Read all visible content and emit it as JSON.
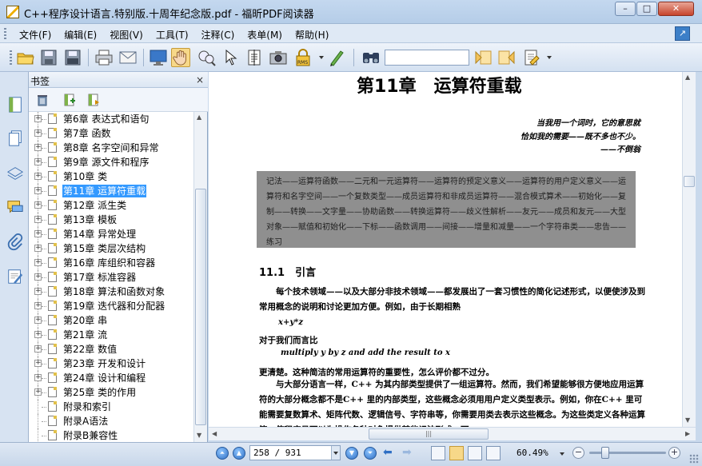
{
  "window": {
    "title": "C++程序设计语言.特别版.十周年纪念版.pdf - 福昕PDF阅读器",
    "minimize": "–",
    "maximize": "□",
    "close": "✕"
  },
  "menubar": {
    "items": [
      "文件(F)",
      "编辑(E)",
      "视图(V)",
      "工具(T)",
      "注释(C)",
      "表单(M)",
      "帮助(H)"
    ]
  },
  "toolbar": {
    "icons": [
      "open-icon",
      "save-icon",
      "save-as-icon",
      "print-icon",
      "email-icon",
      "fullscreen-icon",
      "hand-icon",
      "zoom-tool-icon",
      "select-icon",
      "text-select-icon",
      "snapshot-icon",
      "rms-icon",
      "typewriter-icon",
      "find-icon",
      "find-prev-icon",
      "find-next-icon",
      "highlight-icon"
    ],
    "search_value": ""
  },
  "bookmarks": {
    "title": "书签",
    "close": "×",
    "items": [
      {
        "label": "第6章 表达式和语句",
        "leaf": false
      },
      {
        "label": "第7章 函数",
        "leaf": false
      },
      {
        "label": "第8章 名字空间和异常",
        "leaf": false
      },
      {
        "label": "第9章 源文件和程序",
        "leaf": false
      },
      {
        "label": "第10章 类",
        "leaf": false
      },
      {
        "label": "第11章 运算符重载",
        "leaf": false,
        "selected": true
      },
      {
        "label": "第12章 派生类",
        "leaf": false
      },
      {
        "label": "第13章 模板",
        "leaf": false
      },
      {
        "label": "第14章 异常处理",
        "leaf": false
      },
      {
        "label": "第15章 类层次结构",
        "leaf": false
      },
      {
        "label": "第16章 库组织和容器",
        "leaf": false
      },
      {
        "label": "第17章 标准容器",
        "leaf": false
      },
      {
        "label": "第18章 算法和函数对象",
        "leaf": false
      },
      {
        "label": "第19章 迭代器和分配器",
        "leaf": false
      },
      {
        "label": "第20章 串",
        "leaf": false
      },
      {
        "label": "第21章 流",
        "leaf": false
      },
      {
        "label": "第22章 数值",
        "leaf": false
      },
      {
        "label": "第23章 开发和设计",
        "leaf": false
      },
      {
        "label": "第24章 设计和编程",
        "leaf": false
      },
      {
        "label": "第25章 类的作用",
        "leaf": false
      },
      {
        "label": "附录和索引",
        "leaf": true
      },
      {
        "label": "附录A语法",
        "leaf": true
      },
      {
        "label": "附录B兼容性",
        "leaf": true
      }
    ]
  },
  "document": {
    "chapter_title": "第11章　运算符重载",
    "epigraph": [
      "当我用一个词时，它的意思就",
      "恰如我的需要——既不多也不少。",
      "——不倒翁"
    ],
    "keywords": "记法——运算符函数——二元和一元运算符——运算符的预定义意义——运算符的用户定义意义——运算符和名字空间——一个复数类型——成员运算符和非成员运算符——混合模式算术——初始化——复制——转换——文字量——协助函数——转换运算符——歧义性解析——友元——成员和友元——大型对象——赋值和初始化——下标——函数调用——间接——增量和减量——一个字符串类——忠告——练习",
    "section_heading": "11.1　引言",
    "para1": "　　每个技术领域——以及大部分非技术领域——都发展出了一套习惯性的简化记述形式，以便使涉及到常用概念的说明和讨论更加方便。例如，由于长期相熟",
    "code1": "x+y*z",
    "para2": "对于我们而言比",
    "code2": "multiply y by z and add the result to x",
    "para3": "更清楚。这种简洁的常用运算符的重要性，怎么评价都不过分。",
    "para4": "　　与大部分语言一样，C++ 为其内部类型提供了一组运算符。然而，我们希望能够很方便地应用运算符的大部分概念都不是C++ 里的内部类型，这些概念必须用用户定义类型表示。例如，你在C++ 里可能需要复数算术、矩阵代数、逻辑信号、字符串等，你需要用类去表示这些概念。为这些类定义各种运算符，使程序员可以为操作各种对象提供某些记法形式，可"
  },
  "statusbar": {
    "page_value": "258 / 931",
    "zoom_value": "60.49%",
    "zoom_minus": "−",
    "zoom_plus": "+",
    "zoom_fraction": 0.21
  }
}
